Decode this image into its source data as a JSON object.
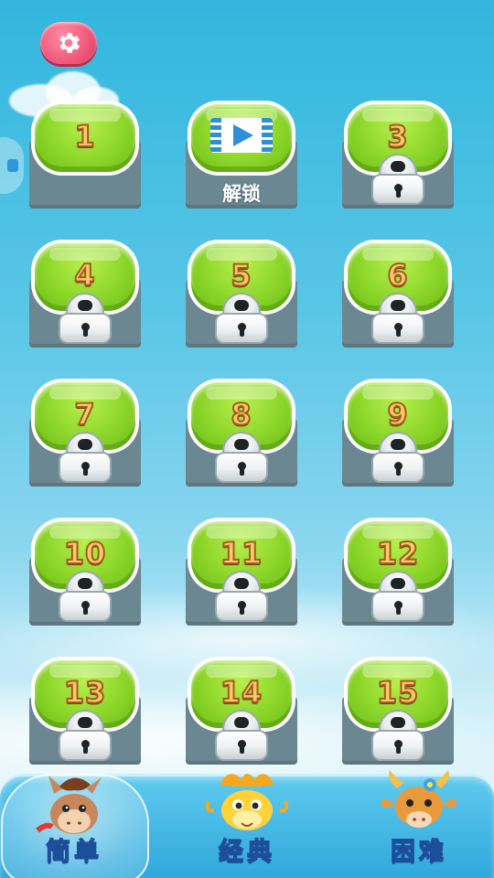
{
  "settings": {
    "icon": "gear-icon",
    "color": "#f0577a"
  },
  "side_tab": {
    "icon": "ad-icon"
  },
  "levels": [
    {
      "number": "1",
      "state": "unlocked"
    },
    {
      "number": "",
      "state": "video",
      "label": "解锁"
    },
    {
      "number": "3",
      "state": "locked"
    },
    {
      "number": "4",
      "state": "locked"
    },
    {
      "number": "5",
      "state": "locked"
    },
    {
      "number": "6",
      "state": "locked"
    },
    {
      "number": "7",
      "state": "locked"
    },
    {
      "number": "8",
      "state": "locked"
    },
    {
      "number": "9",
      "state": "locked"
    },
    {
      "number": "10",
      "state": "locked"
    },
    {
      "number": "11",
      "state": "locked"
    },
    {
      "number": "12",
      "state": "locked"
    },
    {
      "number": "13",
      "state": "locked"
    },
    {
      "number": "14",
      "state": "locked"
    },
    {
      "number": "15",
      "state": "locked"
    }
  ],
  "modes": [
    {
      "label": "简单",
      "mascot": "horse",
      "selected": true
    },
    {
      "label": "经典",
      "mascot": "dragon",
      "selected": false
    },
    {
      "label": "困难",
      "mascot": "ox",
      "selected": false
    }
  ],
  "colors": {
    "tile_green": "#8cd629",
    "tile_base": "#6b8791",
    "number_fill": "#ffc96a",
    "mode_bar": "#2fa8dc"
  }
}
